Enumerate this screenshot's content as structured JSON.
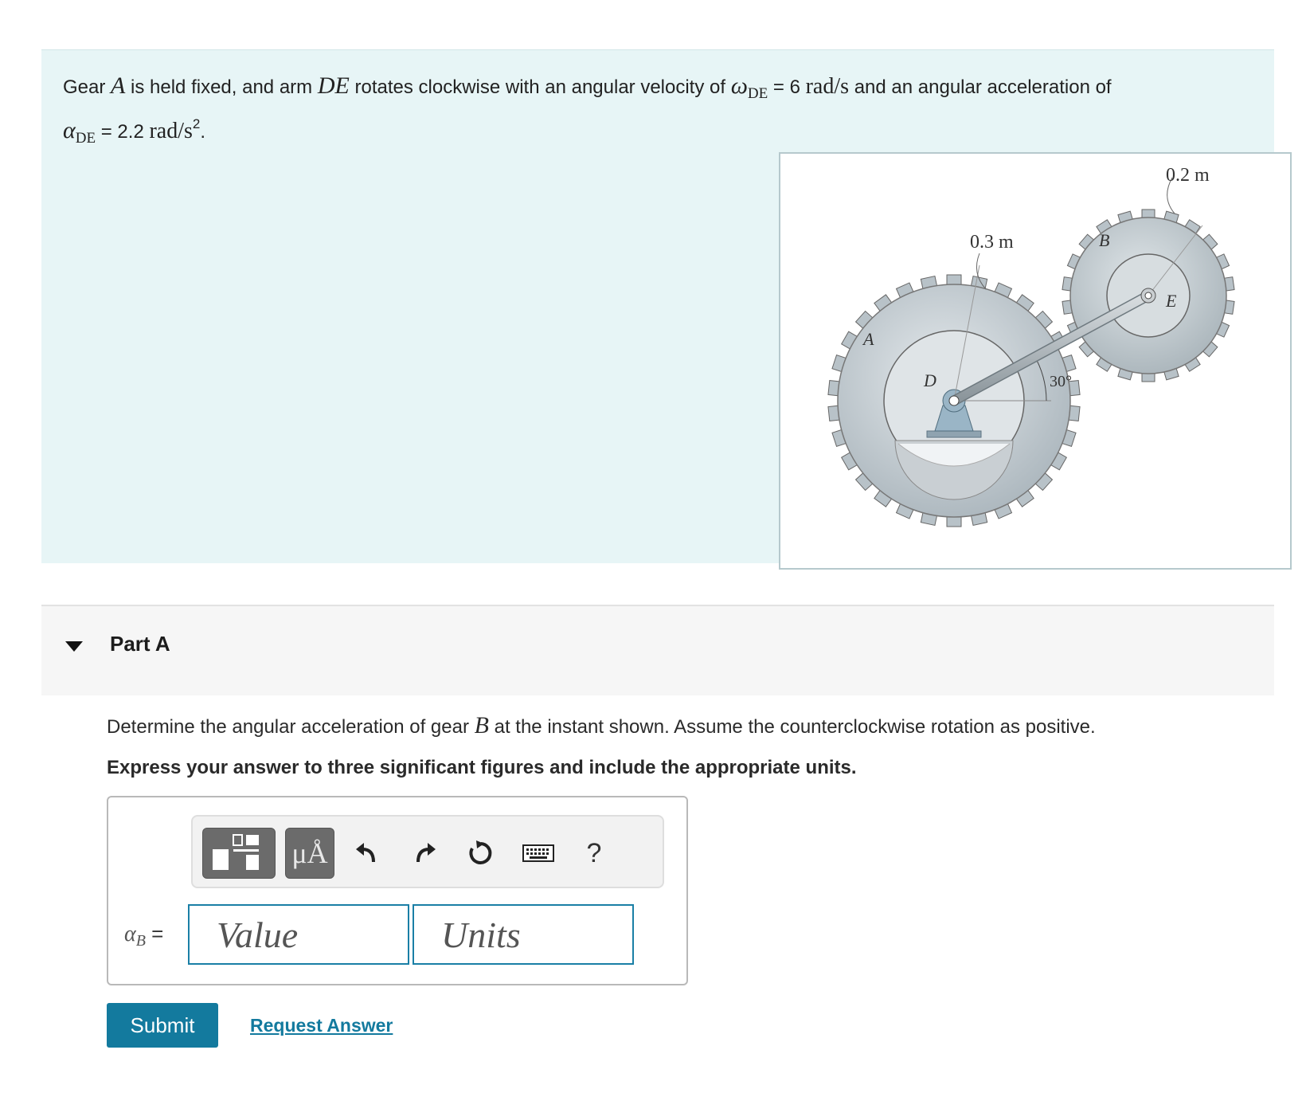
{
  "problem": {
    "t1": "Gear ",
    "v_A": "A",
    "t2": " is held fixed, and arm ",
    "v_DE": "DE",
    "t3": " rotates clockwise with an angular velocity of ",
    "omega_sym": "ω",
    "omega_sub": "DE",
    "eq1": " = 6 ",
    "unit1": "rad/s",
    "t4": " and an angular acceleration of",
    "alpha_sym": "α",
    "alpha_sub": "DE",
    "eq2": " = 2.2 ",
    "unit2": "rad/s",
    "unit2_exp": "2",
    "t5": "."
  },
  "figure": {
    "label_02m": "0.2 m",
    "label_03m": "0.3 m",
    "label_A": "A",
    "label_B": "B",
    "label_D": "D",
    "label_E": "E",
    "label_30": "30°"
  },
  "part": {
    "title": "Part A",
    "question_pre": "Determine the angular acceleration of gear ",
    "question_var": "B",
    "question_post": " at the instant shown. Assume the counterclockwise rotation as positive.",
    "instruction": "Express your answer to three significant figures and include the appropriate units."
  },
  "toolbar": {
    "units_glyph": "μÅ",
    "help_glyph": "?"
  },
  "answer": {
    "var_sym": "α",
    "var_sub": "B",
    "equals": " =",
    "value_placeholder": "Value",
    "units_placeholder": "Units"
  },
  "actions": {
    "submit": "Submit",
    "request": "Request Answer"
  },
  "colors": {
    "accent": "#137a9e",
    "problem_bg": "#e7f5f6",
    "part_bg": "#f6f6f6"
  }
}
